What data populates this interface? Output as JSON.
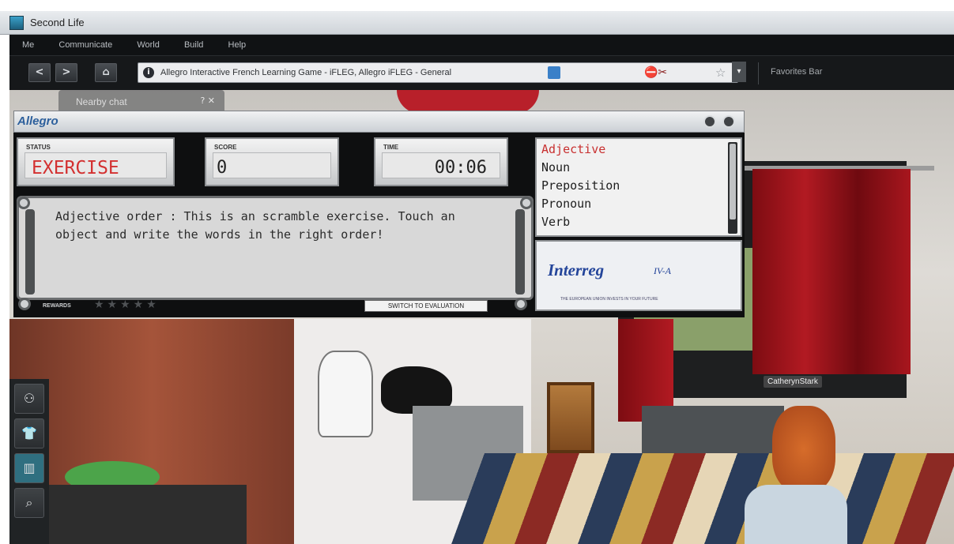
{
  "window": {
    "title": "Second Life"
  },
  "menu": [
    "Me",
    "Communicate",
    "World",
    "Build",
    "Help"
  ],
  "nav": {
    "back": "<",
    "forward": ">",
    "home": "⌂",
    "url": "Allegro Interactive French Learning Game - iFLEG, Allegro iFLEG - General",
    "dropdown": "▾",
    "favorites_bar": "Favorites Bar"
  },
  "hud": {
    "tab_title": "Nearby chat",
    "logo": "Allegro",
    "status": {
      "label": "STATUS",
      "value": "EXERCISE"
    },
    "score": {
      "label": "SCORE",
      "value": "0"
    },
    "time": {
      "label": "TIME",
      "value": "00:06"
    },
    "message": "Adjective order : This is an scramble exercise. Touch an object and write the words in the right order!",
    "rewards_label": "REWARDS",
    "stars": "★★★★★",
    "switch_button": "SWITCH TO EVALUATION",
    "words": [
      "Adjective",
      "Noun",
      "Preposition",
      "Pronoun",
      "Verb"
    ],
    "selected_word_index": 0,
    "interreg": {
      "name": "Interreg",
      "suffix": "IV-A",
      "tagline": "THE EUROPEAN UNION INVESTS IN YOUR FUTURE"
    }
  },
  "toolbar_icons": [
    "people-icon",
    "shirt-icon",
    "map-icon",
    "search-icon"
  ],
  "avatar_name": "CatherynStark",
  "colors": {
    "status_red": "#d33030",
    "selected_word": "#c83030",
    "interreg_blue": "#24459a",
    "allegro_blue": "#2c5f9c"
  }
}
